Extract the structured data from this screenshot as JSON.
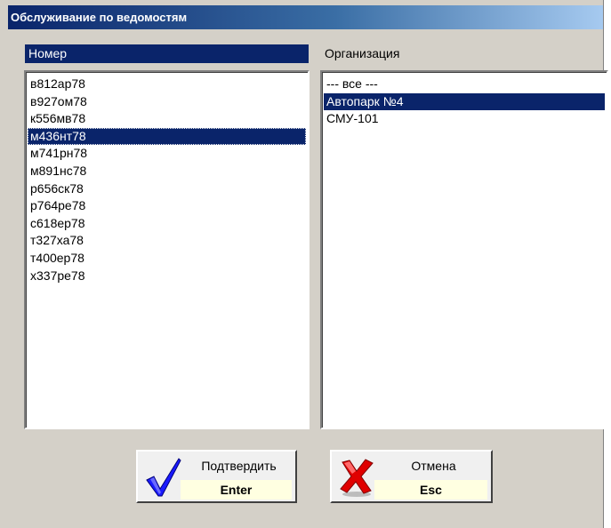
{
  "window": {
    "title": "Обслуживание по ведомостям"
  },
  "columns": {
    "left_header": "Номер",
    "right_header": "Организация"
  },
  "numbers": [
    "в812ар78",
    "в927ом78",
    "к556мв78",
    "м436нт78",
    "м741рн78",
    "м891нс78",
    "р656ск78",
    "р764ре78",
    "с618ер78",
    "т327ха78",
    "т400ер78",
    "х337ре78"
  ],
  "numbers_selected": "м436нт78",
  "organizations": [
    "--- все ---",
    "Автопарк №4",
    "СМУ-101"
  ],
  "organizations_selected": "Автопарк №4",
  "buttons": {
    "confirm": {
      "label": "Подтвердить",
      "key": "Enter",
      "icon": "checkmark-icon"
    },
    "cancel": {
      "label": "Отмена",
      "key": "Esc",
      "icon": "red-x-icon"
    }
  },
  "colors": {
    "selection": "#0a246a",
    "window_bg": "#d4d0c8",
    "key_bg": "#ffffe1",
    "cancel_icon": "#e00000",
    "confirm_icon": "#0000cc"
  }
}
